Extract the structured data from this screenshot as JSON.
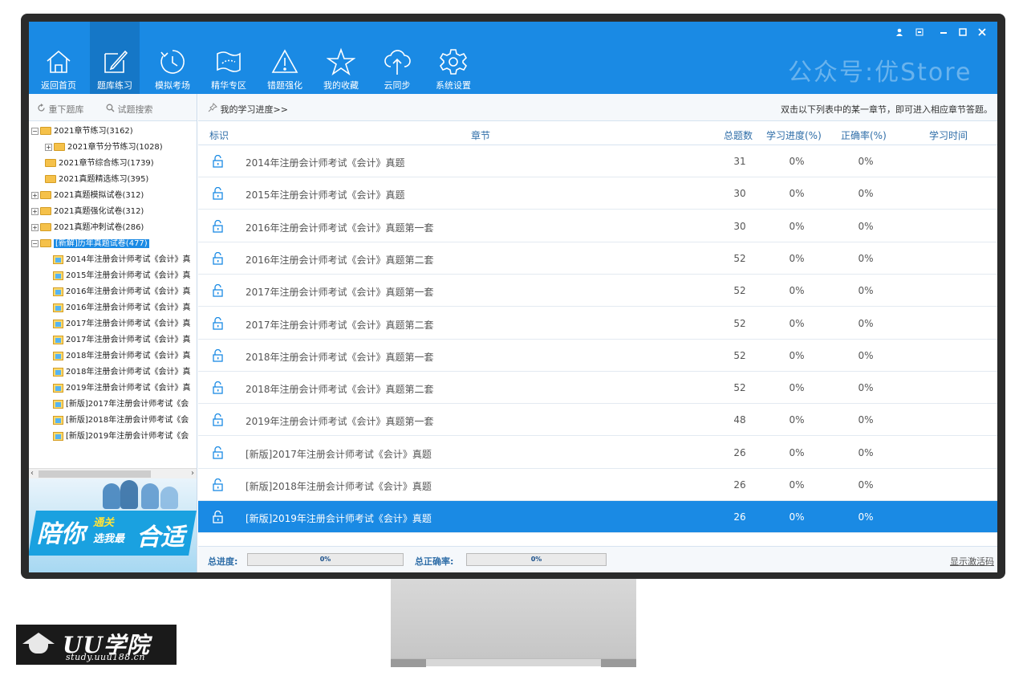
{
  "toolbar": {
    "items": [
      {
        "label": "返回首页",
        "icon": "home-icon"
      },
      {
        "label": "题库练习",
        "icon": "edit-icon"
      },
      {
        "label": "模拟考场",
        "icon": "clock-icon"
      },
      {
        "label": "精华专区",
        "icon": "map-icon"
      },
      {
        "label": "错题强化",
        "icon": "warning-icon"
      },
      {
        "label": "我的收藏",
        "icon": "star-icon"
      },
      {
        "label": "云同步",
        "icon": "cloud-icon"
      },
      {
        "label": "系统设置",
        "icon": "gear-icon"
      }
    ],
    "active_index": 1,
    "watermark": "公众号:优Store"
  },
  "left": {
    "reload_label": "重下题库",
    "search_label": "试题搜索",
    "tree": [
      {
        "label": "2021章节练习(3162)",
        "level": 0,
        "expander": "−",
        "type": "folder-open"
      },
      {
        "label": "2021章节分节练习(1028)",
        "level": 1,
        "expander": "+",
        "type": "folder"
      },
      {
        "label": "2021章节综合练习(1739)",
        "level": 1,
        "expander": "",
        "type": "folder"
      },
      {
        "label": "2021真题精选练习(395)",
        "level": 1,
        "expander": "",
        "type": "folder"
      },
      {
        "label": "2021真题模拟试卷(312)",
        "level": 0,
        "expander": "+",
        "type": "folder"
      },
      {
        "label": "2021真题强化试卷(312)",
        "level": 0,
        "expander": "+",
        "type": "folder"
      },
      {
        "label": "2021真题冲刺试卷(286)",
        "level": 0,
        "expander": "+",
        "type": "folder"
      },
      {
        "label": "[新解]历年真题试卷(477)",
        "level": 0,
        "expander": "−",
        "type": "folder-open",
        "selected": true
      },
      {
        "label": "2014年注册会计师考试《会计》真",
        "level": 1,
        "expander": "",
        "type": "file"
      },
      {
        "label": "2015年注册会计师考试《会计》真",
        "level": 1,
        "expander": "",
        "type": "file"
      },
      {
        "label": "2016年注册会计师考试《会计》真",
        "level": 1,
        "expander": "",
        "type": "file"
      },
      {
        "label": "2016年注册会计师考试《会计》真",
        "level": 1,
        "expander": "",
        "type": "file"
      },
      {
        "label": "2017年注册会计师考试《会计》真",
        "level": 1,
        "expander": "",
        "type": "file"
      },
      {
        "label": "2017年注册会计师考试《会计》真",
        "level": 1,
        "expander": "",
        "type": "file"
      },
      {
        "label": "2018年注册会计师考试《会计》真",
        "level": 1,
        "expander": "",
        "type": "file"
      },
      {
        "label": "2018年注册会计师考试《会计》真",
        "level": 1,
        "expander": "",
        "type": "file"
      },
      {
        "label": "2019年注册会计师考试《会计》真",
        "level": 1,
        "expander": "",
        "type": "file"
      },
      {
        "label": "[新版]2017年注册会计师考试《会",
        "level": 1,
        "expander": "",
        "type": "file"
      },
      {
        "label": "[新版]2018年注册会计师考试《会",
        "level": 1,
        "expander": "",
        "type": "file"
      },
      {
        "label": "[新版]2019年注册会计师考试《会",
        "level": 1,
        "expander": "",
        "type": "file"
      }
    ],
    "banner": {
      "main1": "陪你",
      "top": "通关",
      "bottom": "选我最",
      "main2": "合适"
    }
  },
  "right": {
    "progress_link": "我的学习进度>>",
    "hint": "双击以下列表中的某一章节，即可进入相应章节答题。",
    "columns": {
      "mark": "标识",
      "chapter": "章节",
      "total": "总题数",
      "progress": "学习进度(%)",
      "accuracy": "正确率(%)",
      "time": "学习时间"
    },
    "rows": [
      {
        "title": "2014年注册会计师考试《会计》真题",
        "total": "31",
        "progress": "0%",
        "accuracy": "0%",
        "time": ""
      },
      {
        "title": "2015年注册会计师考试《会计》真题",
        "total": "30",
        "progress": "0%",
        "accuracy": "0%",
        "time": ""
      },
      {
        "title": "2016年注册会计师考试《会计》真题第一套",
        "total": "30",
        "progress": "0%",
        "accuracy": "0%",
        "time": ""
      },
      {
        "title": "2016年注册会计师考试《会计》真题第二套",
        "total": "52",
        "progress": "0%",
        "accuracy": "0%",
        "time": ""
      },
      {
        "title": "2017年注册会计师考试《会计》真题第一套",
        "total": "52",
        "progress": "0%",
        "accuracy": "0%",
        "time": ""
      },
      {
        "title": "2017年注册会计师考试《会计》真题第二套",
        "total": "52",
        "progress": "0%",
        "accuracy": "0%",
        "time": ""
      },
      {
        "title": "2018年注册会计师考试《会计》真题第一套",
        "total": "52",
        "progress": "0%",
        "accuracy": "0%",
        "time": ""
      },
      {
        "title": "2018年注册会计师考试《会计》真题第二套",
        "total": "52",
        "progress": "0%",
        "accuracy": "0%",
        "time": ""
      },
      {
        "title": "2019年注册会计师考试《会计》真题第一套",
        "total": "48",
        "progress": "0%",
        "accuracy": "0%",
        "time": ""
      },
      {
        "title": "[新版]2017年注册会计师考试《会计》真题",
        "total": "26",
        "progress": "0%",
        "accuracy": "0%",
        "time": ""
      },
      {
        "title": "[新版]2018年注册会计师考试《会计》真题",
        "total": "26",
        "progress": "0%",
        "accuracy": "0%",
        "time": ""
      },
      {
        "title": "[新版]2019年注册会计师考试《会计》真题",
        "total": "26",
        "progress": "0%",
        "accuracy": "0%",
        "time": "",
        "selected": true
      }
    ],
    "footer": {
      "total_progress_label": "总进度:",
      "total_progress_value": "0%",
      "total_accuracy_label": "总正确率:",
      "total_accuracy_value": "0%",
      "activation_link": "显示激活码"
    }
  },
  "logo": {
    "title": "UU学院",
    "url": "study.uuu188.cn"
  },
  "colors": {
    "accent": "#1a8ae4",
    "active_tab": "#1577c7",
    "header_text": "#2f6ea8"
  }
}
